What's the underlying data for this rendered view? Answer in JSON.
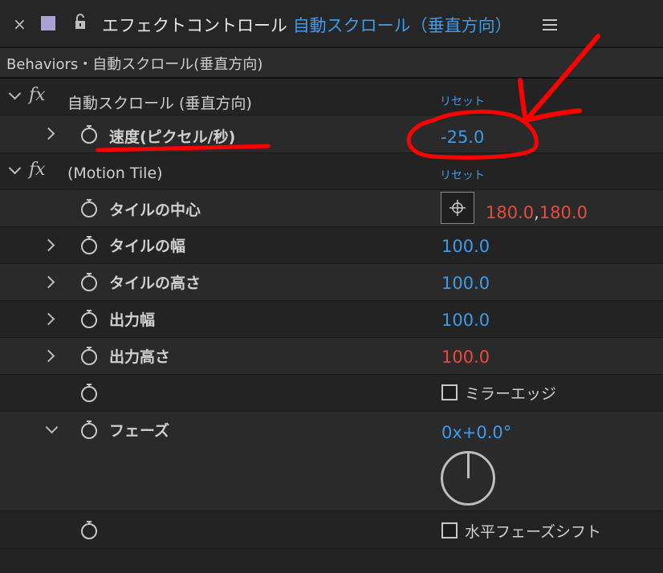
{
  "tab": {
    "close": "×",
    "title": "エフェクトコントロール",
    "layer": "自動スクロール（垂直方向）"
  },
  "header": "Behaviors・自動スクロール(垂直方向)",
  "effects": [
    {
      "name": "自動スクロール (垂直方向)",
      "reset": "リセット",
      "properties": [
        {
          "label": "速度(ピクセル/秒)",
          "value": "-25.0"
        }
      ]
    },
    {
      "name": "(Motion Tile)",
      "reset": "リセット",
      "properties": [
        {
          "label": "タイルの中心",
          "value_x": "180.0",
          "sep": ",",
          "value_y": "180.0"
        },
        {
          "label": "タイルの幅",
          "value": "100.0"
        },
        {
          "label": "タイルの高さ",
          "value": "100.0"
        },
        {
          "label": "出力幅",
          "value": "100.0"
        },
        {
          "label": "出力高さ",
          "value": "100.0"
        },
        {
          "label": "",
          "checkbox": "ミラーエッジ",
          "checked": false
        },
        {
          "label": "フェーズ",
          "value": "0x+0.0°",
          "dial_degrees": 0
        },
        {
          "label": "",
          "checkbox": "水平フェーズシフト",
          "checked": false
        }
      ]
    }
  ],
  "colors": {
    "accent_blue": "#3d9be9",
    "value_red": "#e84b3c",
    "annotation_red": "#ff0000"
  },
  "icons": [
    "close-icon",
    "lock-icon",
    "panel-menu-icon",
    "fx-icon",
    "stopwatch-icon",
    "anchor-point-icon",
    "angle-dial-icon"
  ]
}
